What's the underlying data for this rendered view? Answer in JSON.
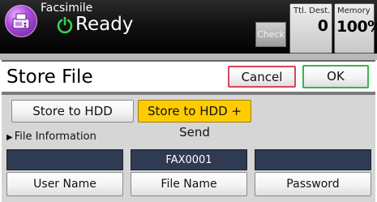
{
  "header": {
    "app_title": "Facsimile",
    "status": "Ready",
    "check_label": "Check",
    "dest_label": "Ttl. Dest.",
    "dest_count": "0",
    "memory_label": "Memory",
    "memory_value": "100%"
  },
  "title_bar": {
    "title": "Store File",
    "cancel_label": "Cancel",
    "ok_label": "OK"
  },
  "options": {
    "store_hdd_label": "Store to HDD",
    "store_hdd_send_label": "Store to HDD + Send",
    "selected": "Store to HDD + Send"
  },
  "file_info": {
    "section_label": "File Information",
    "fields": [
      {
        "value": "",
        "label": "User Name"
      },
      {
        "value": "FAX0001",
        "label": "File Name"
      },
      {
        "value": "",
        "label": "Password"
      }
    ]
  },
  "colors": {
    "selected_option": "#ffcc00",
    "cancel_border": "#d8465a",
    "ok_border": "#3ab54a",
    "field_value_bg": "#2f3b52"
  }
}
